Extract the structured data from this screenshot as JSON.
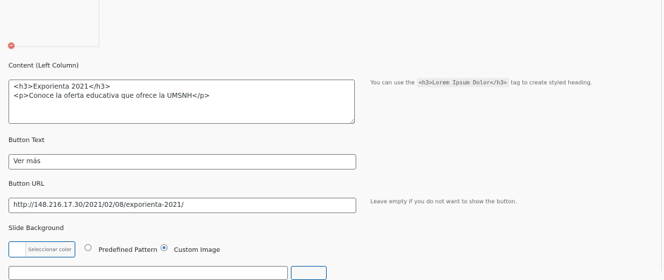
{
  "content": {
    "label": "Content (Left Column)",
    "value": "<h3>Exporienta 2021</h3>\n<p>Conoce la oferta educativa que ofrece la UMSNH</p>",
    "help_prefix": "You can use the",
    "help_code": "<h3>Lorem Ipsum Dolor</h3>",
    "help_suffix": "tag to create styled heading."
  },
  "button_text": {
    "label": "Button Text",
    "value": "Ver más"
  },
  "button_url": {
    "label": "Button URL",
    "value": "http://148.216.17.30/2021/02/08/exporienta-2021/",
    "help": "Leave empty if you do not want to show the button."
  },
  "slide_background": {
    "label": "Slide Background",
    "color_button": "Seleccionar color",
    "options": [
      "Predefined Pattern",
      "Custom Image"
    ],
    "selected": "Custom Image"
  },
  "colors": {
    "accent": "#2271b1",
    "remove": "#e2706a"
  }
}
